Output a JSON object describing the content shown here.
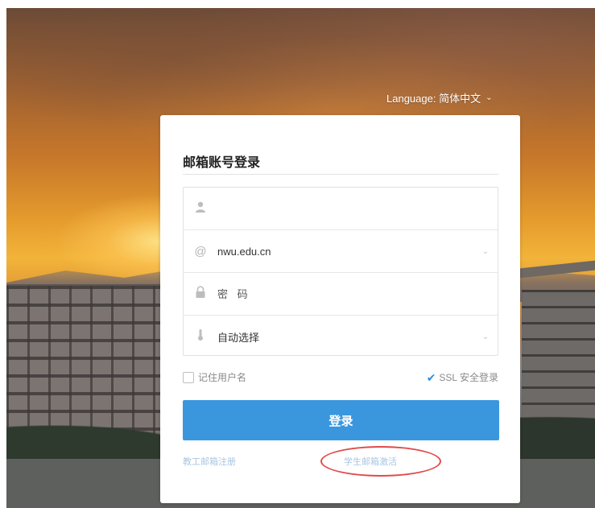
{
  "language": {
    "label": "Language: 简体中文",
    "chevron": "⌄"
  },
  "login": {
    "title": "邮箱账号登录",
    "username": {
      "icon": "user-icon",
      "value": "",
      "placeholder": ""
    },
    "domain": {
      "icon": "at-icon",
      "value": "nwu.edu.cn"
    },
    "password": {
      "icon": "lock-icon",
      "placeholder": "密 码"
    },
    "mode": {
      "icon": "thermometer-icon",
      "value": "自动选择"
    },
    "remember_label": "记住用户名",
    "ssl_label": "SSL 安全登录",
    "submit_label": "登录",
    "staff_register_link": "教工邮箱注册",
    "student_activate_link": "学生邮箱激活"
  },
  "colors": {
    "primary_button": "#3a97de",
    "annotation_circle": "#e14a4a"
  }
}
